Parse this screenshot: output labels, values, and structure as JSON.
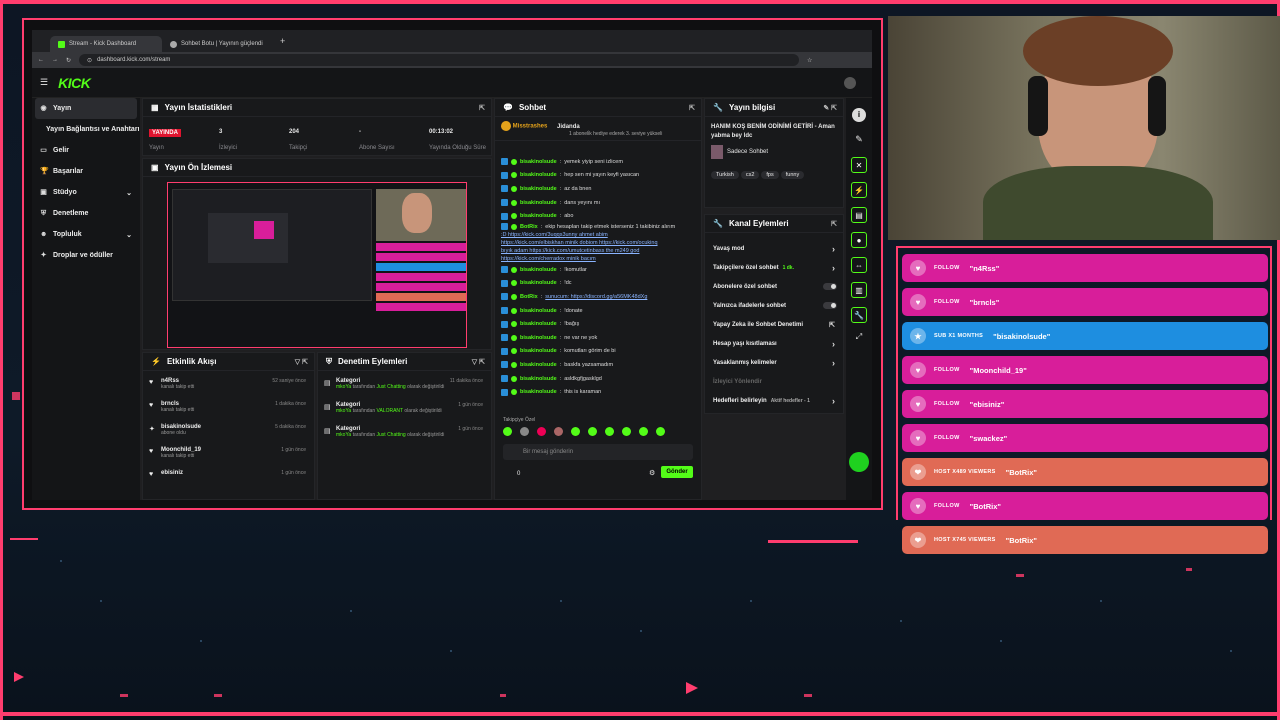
{
  "browser": {
    "tabs": [
      {
        "label": "Stream - Kick Dashboard"
      },
      {
        "label": "Sohbet Botu | Yayının güçlendi"
      }
    ],
    "url": "dashboard.kick.com/stream"
  },
  "kick": {
    "logo": "KICK"
  },
  "sidebar": {
    "items": [
      {
        "label": "Yayın",
        "icon": "broadcast-icon"
      },
      {
        "label": "Yayın Bağlantısı ve Anahtarı",
        "icon": ""
      },
      {
        "label": "Gelir",
        "icon": "wallet-icon"
      },
      {
        "label": "Başarılar",
        "icon": "trophy-icon"
      },
      {
        "label": "Stüdyo",
        "icon": "studio-icon"
      },
      {
        "label": "Denetleme",
        "icon": "shield-icon"
      },
      {
        "label": "Topluluk",
        "icon": "community-icon"
      },
      {
        "label": "Droplar ve ödüller",
        "icon": "gift-icon"
      }
    ]
  },
  "stats": {
    "title": "Yayın İstatistikleri",
    "live": "YAYINDA",
    "live_label": "Yayın",
    "viewers": "3",
    "viewers_label": "İzleyici",
    "followers": "204",
    "followers_label": "Takipçi",
    "subs": "-",
    "subs_label": "Abone Sayısı",
    "duration": "00:13:02",
    "duration_label": "Yayında Olduğu Süre"
  },
  "preview": {
    "title": "Yayın Ön İzlemesi"
  },
  "activity": {
    "title": "Etkinlik Akışı",
    "items": [
      {
        "name": "n4Rss",
        "desc": "kanalı takip etti",
        "time": "52 saniye önce"
      },
      {
        "name": "brncls",
        "desc": "kanalı takip etti",
        "time": "1 dakika önce"
      },
      {
        "name": "bisakinolsude",
        "desc": "abone oldu",
        "time": "5 dakika önce"
      },
      {
        "name": "Moonchild_19",
        "desc": "kanalı takip etti",
        "time": "1 gün önce"
      },
      {
        "name": "ebisiniz",
        "desc": "",
        "time": "1 gün önce"
      }
    ]
  },
  "moderation": {
    "title": "Denetim Eylemleri",
    "items": [
      {
        "title": "Kategori",
        "user": "mkoYa",
        "text": "tarafından",
        "cat": "Just Chatting",
        "tail": "olarak değiştirildi",
        "time": "11 dakika önce"
      },
      {
        "title": "Kategori",
        "user": "mkoYa",
        "text": "tarafından",
        "cat": "VALORANT",
        "tail": "olarak değiştirildi",
        "time": "1 gün önce"
      },
      {
        "title": "Kategori",
        "user": "mkoYa",
        "text": "tarafından",
        "cat": "Just Chatting",
        "tail": "olarak değiştirildi",
        "time": "1 gün önce"
      }
    ]
  },
  "chat": {
    "title": "Sohbet",
    "pinned_user1": "Misstrashes",
    "pinned_user2": "Jidanda",
    "pinned_text": "1 aboneli̇k hediye ederek 3. seviye yükseli",
    "messages": [
      {
        "user": "bisakinolsude",
        "text": "yemek yiyip seni izlicem"
      },
      {
        "user": "bisakinolsude",
        "text": "hep sen mi yayın keyfi yasıcan"
      },
      {
        "user": "bisakinolsude",
        "text": "az da bnen"
      },
      {
        "user": "bisakinolsude",
        "text": "dans yeyını mı"
      },
      {
        "user": "bisakinolsude",
        "text": "abo"
      },
      {
        "user": "BotRix",
        "text": "ekip hesapları takip etmek isterseniz 1 takibiniz alırım"
      },
      {
        "user": "",
        "text": ":D https://kick.com/3uqqs3unny ahmet abim"
      },
      {
        "user": "",
        "text": "https://kick.com/elbiskhan minik dobiom https://kick.com/ocukinq"
      },
      {
        "user": "",
        "text": "bıyık adam https://kick.com/umutcetinbass the m249 god"
      },
      {
        "user": "",
        "text": "https://kick.com/cherradox minik bacım"
      },
      {
        "user": "bisakinolsude",
        "text": "!komutlar"
      },
      {
        "user": "bisakinolsude",
        "text": "!dc"
      },
      {
        "user": "BotRix",
        "text": "sunucum: https://discord.gg/a56MK48dXg"
      },
      {
        "user": "bisakinolsude",
        "text": "!donate"
      },
      {
        "user": "bisakinolsude",
        "text": "!bağış"
      },
      {
        "user": "bisakinolsude",
        "text": "ne var ne yok"
      },
      {
        "user": "bisakinolsude",
        "text": "komutları görim de bi"
      },
      {
        "user": "bisakinolsude",
        "text": "baskfa yazsamadım"
      },
      {
        "user": "bisakinolsude",
        "text": "asldkgfjgasklgd"
      },
      {
        "user": "bisakinolsude",
        "text": "this is karaman"
      }
    ],
    "followers_only": "Takipçiye Özel",
    "placeholder": "Bir mesaj gönderin",
    "count": "0",
    "send": "Gönder"
  },
  "info": {
    "title": "Yayın bilgisi",
    "stream_title": "HANIM KOŞ BENİM ODİNİMİ GETİRİ - Aman yabma bey ldc",
    "category": "Sadece Sohbet",
    "tags": [
      "Turkish",
      "cs2",
      "fps",
      "funny"
    ]
  },
  "actions": {
    "title": "Kanal Eylemleri",
    "items": [
      {
        "label": "Yavaş mod"
      },
      {
        "label": "Takipçilere özel sohbet",
        "sub": "1 dk."
      },
      {
        "label": "Abonelere özel sohbet"
      },
      {
        "label": "Yalnızca ifadelerle sohbet"
      },
      {
        "label": "Yapay Zeka ile Sohbet Denetimi"
      },
      {
        "label": "Hesap yaşı kısıtlaması"
      },
      {
        "label": "Yasaklanmış kelimeler"
      },
      {
        "label": "İzleyici Yönlendir"
      },
      {
        "label": "Hedefleri belirleyin",
        "sub": "Aktif hedefler - 1"
      }
    ]
  },
  "alerts": [
    {
      "kind": "FOLLOW",
      "name": "\"n4Rss\"",
      "type": "follow"
    },
    {
      "kind": "FOLLOW",
      "name": "\"brncls\"",
      "type": "follow"
    },
    {
      "kind": "SUB X1 MONTHS",
      "name": "\"bisakinolsude\"",
      "type": "sub"
    },
    {
      "kind": "FOLLOW",
      "name": "\"Moonchild_19\"",
      "type": "follow"
    },
    {
      "kind": "FOLLOW",
      "name": "\"ebisiniz\"",
      "type": "follow"
    },
    {
      "kind": "FOLLOW",
      "name": "\"swackez\"",
      "type": "follow"
    },
    {
      "kind": "HOST X489 VIEWERS",
      "name": "\"BotRix\"",
      "type": "host"
    },
    {
      "kind": "FOLLOW",
      "name": "\"BotRix\"",
      "type": "follow"
    },
    {
      "kind": "HOST X745 VIEWERS",
      "name": "\"BotRix\"",
      "type": "host"
    }
  ],
  "colors": {
    "accent": "#53fc18",
    "overlay": "#ff3d6e",
    "follow": "#d81e9a",
    "sub": "#1e8ee0",
    "host": "#e06a55"
  }
}
